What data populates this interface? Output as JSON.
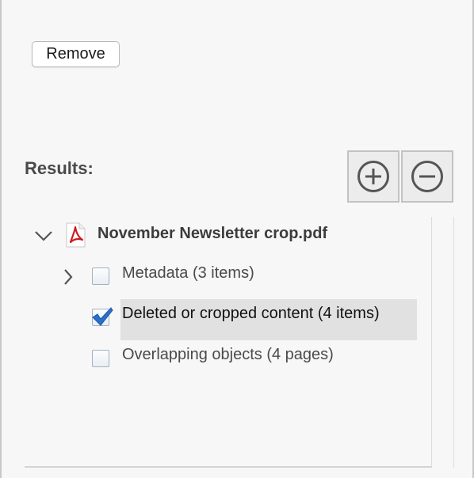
{
  "remove_button": {
    "label": "Remove"
  },
  "results": {
    "label": "Results:",
    "expand_all_icon": "plus-circle-icon",
    "collapse_all_icon": "minus-circle-icon"
  },
  "tree": {
    "root": {
      "file_name": "November Newsletter crop.pdf",
      "icon": "pdf-file-icon",
      "expanded": true
    },
    "items": [
      {
        "label": "Metadata (3 items)",
        "checked": false,
        "expandable": true,
        "selected": false
      },
      {
        "label": "Deleted or cropped content (4 items)",
        "checked": true,
        "expandable": false,
        "selected": true
      },
      {
        "label": "Overlapping objects (4 pages)",
        "checked": false,
        "expandable": false,
        "selected": false
      }
    ]
  },
  "colors": {
    "background": "#f7f7f7",
    "selection": "#e1e1e1",
    "checkmark": "#2a6fc9",
    "pdf_red": "#d0191f"
  }
}
